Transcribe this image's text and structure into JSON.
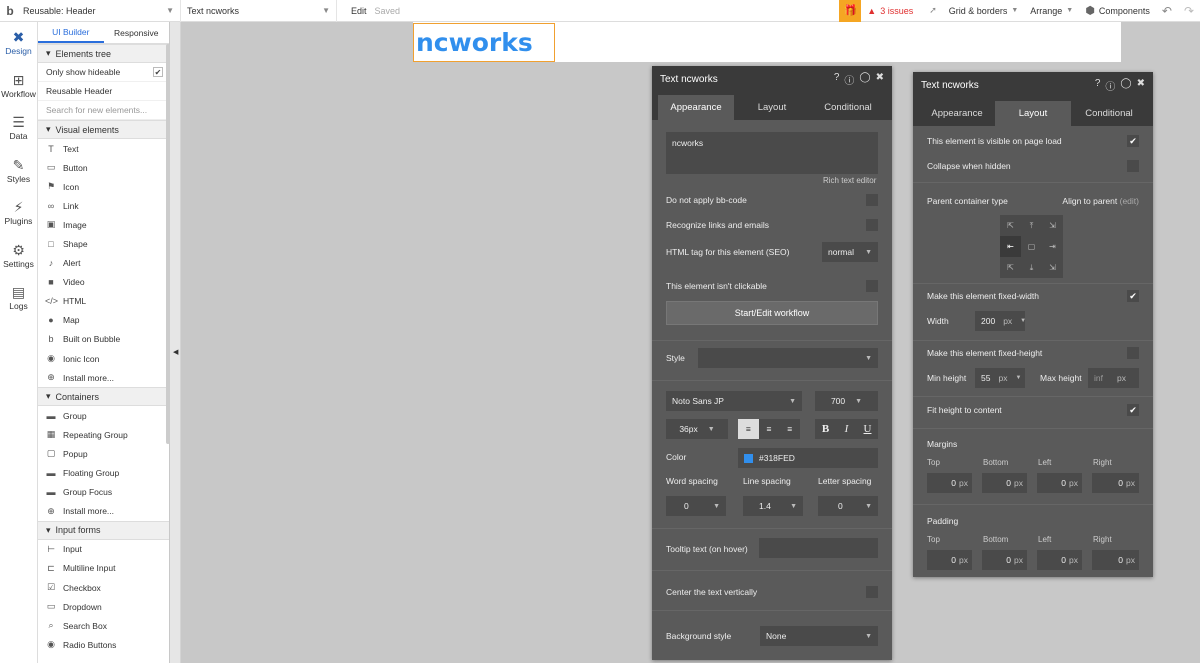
{
  "topbar": {
    "page_name": "Reusable: Header",
    "element_name": "Text ncworks",
    "edit_label": "Edit",
    "saved_label": "Saved",
    "issues_label": "3 issues",
    "grid_label": "Grid & borders",
    "arrange_label": "Arrange",
    "components_label": "Components"
  },
  "left_nav": [
    {
      "label": "Design",
      "icon": "design-icon"
    },
    {
      "label": "Workflow",
      "icon": "workflow-icon"
    },
    {
      "label": "Data",
      "icon": "data-icon"
    },
    {
      "label": "Styles",
      "icon": "styles-icon"
    },
    {
      "label": "Plugins",
      "icon": "plugins-icon"
    },
    {
      "label": "Settings",
      "icon": "settings-icon"
    },
    {
      "label": "Logs",
      "icon": "logs-icon"
    }
  ],
  "sidebar": {
    "tab_ui_builder": "UI Builder",
    "tab_responsive": "Responsive",
    "elements_tree": "Elements tree",
    "only_show_hideable": "Only show hideable",
    "reusable_header": "Reusable Header",
    "search_placeholder": "Search for new elements...",
    "visual_elements": "Visual elements",
    "visual_items": [
      "Text",
      "Button",
      "Icon",
      "Link",
      "Image",
      "Shape",
      "Alert",
      "Video",
      "HTML",
      "Map",
      "Built on Bubble",
      "Ionic Icon",
      "Install more..."
    ],
    "containers": "Containers",
    "container_items": [
      "Group",
      "Repeating Group",
      "Popup",
      "Floating Group",
      "Group Focus",
      "Install more..."
    ],
    "input_forms": "Input forms",
    "input_items": [
      "Input",
      "Multiline Input",
      "Checkbox",
      "Dropdown",
      "Search Box",
      "Radio Buttons"
    ]
  },
  "canvas": {
    "text": "ncworks",
    "color": "#318FED"
  },
  "appearance_panel": {
    "title": "Text ncworks",
    "tabs": [
      "Appearance",
      "Layout",
      "Conditional"
    ],
    "text_value": "ncworks",
    "rich_text_editor": "Rich text editor",
    "do_not_apply_bbcode": "Do not apply bb-code",
    "recognize_links": "Recognize links and emails",
    "html_tag_label": "HTML tag for this element (SEO)",
    "html_tag_value": "normal",
    "not_clickable": "This element isn't clickable",
    "workflow_button": "Start/Edit workflow",
    "style_label": "Style",
    "font_family": "Noto Sans JP",
    "font_weight": "700",
    "font_size": "36px",
    "bold": "B",
    "italic": "I",
    "underline": "U",
    "color_label": "Color",
    "color_value": "#318FED",
    "word_spacing_label": "Word spacing",
    "line_spacing_label": "Line spacing",
    "letter_spacing_label": "Letter spacing",
    "word_spacing": "0",
    "line_spacing": "1.4",
    "letter_spacing": "0",
    "tooltip_label": "Tooltip text (on hover)",
    "center_vert": "Center the text vertically",
    "bg_style_label": "Background style",
    "bg_style_value": "None"
  },
  "layout_panel": {
    "title": "Text ncworks",
    "tabs": [
      "Appearance",
      "Layout",
      "Conditional"
    ],
    "visible_on_load": "This element is visible on page load",
    "collapse_hidden": "Collapse when hidden",
    "parent_type_label": "Parent container type",
    "parent_type_value": "Align to parent",
    "edit_link": "(edit)",
    "fixed_width": "Make this element fixed-width",
    "width_label": "Width",
    "width_value": "200",
    "unit_px": "px",
    "fixed_height": "Make this element fixed-height",
    "min_height_label": "Min height",
    "min_height_value": "55",
    "max_height_label": "Max height",
    "max_height_value": "inf",
    "fit_height": "Fit height to content",
    "margins_label": "Margins",
    "padding_label": "Padding",
    "sides": [
      "Top",
      "Bottom",
      "Left",
      "Right"
    ],
    "zero": "0"
  }
}
